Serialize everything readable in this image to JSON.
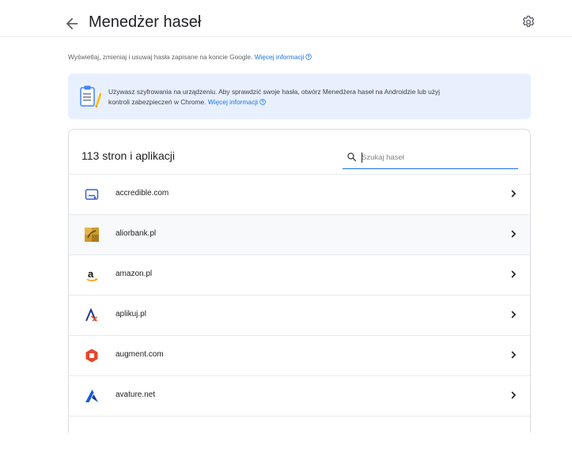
{
  "header": {
    "title": "Menedżer haseł"
  },
  "intro": {
    "text": "Wyświetlaj, zmieniaj i usuwaj hasła zapisane na koncie Google.",
    "link": "Więcej informacji"
  },
  "banner": {
    "line1": "Używasz szyfrowania na urządzeniu. Aby sprawdzić swoje hasła, otwórz Menedżera haseł na Androidzie lub użyj",
    "line2": "kontroli zabezpieczeń w Chrome.",
    "link": "Więcej informacji"
  },
  "passwords": {
    "count_label": "113 stron i aplikacji",
    "search_placeholder": "Szukaj haseł",
    "items": [
      {
        "domain": "accredible.com",
        "icon": "accredible-logo-icon"
      },
      {
        "domain": "aliorbank.pl",
        "icon": "aliorbank-logo-icon"
      },
      {
        "domain": "amazon.pl",
        "icon": "amazon-logo-icon"
      },
      {
        "domain": "aplikuj.pl",
        "icon": "aplikuj-logo-icon"
      },
      {
        "domain": "augment.com",
        "icon": "augment-logo-icon"
      },
      {
        "domain": "avature.net",
        "icon": "avature-logo-icon"
      }
    ]
  },
  "colors": {
    "accent": "#1a73e8",
    "banner_bg": "#e8f0fe",
    "divider": "#e8eaed"
  }
}
